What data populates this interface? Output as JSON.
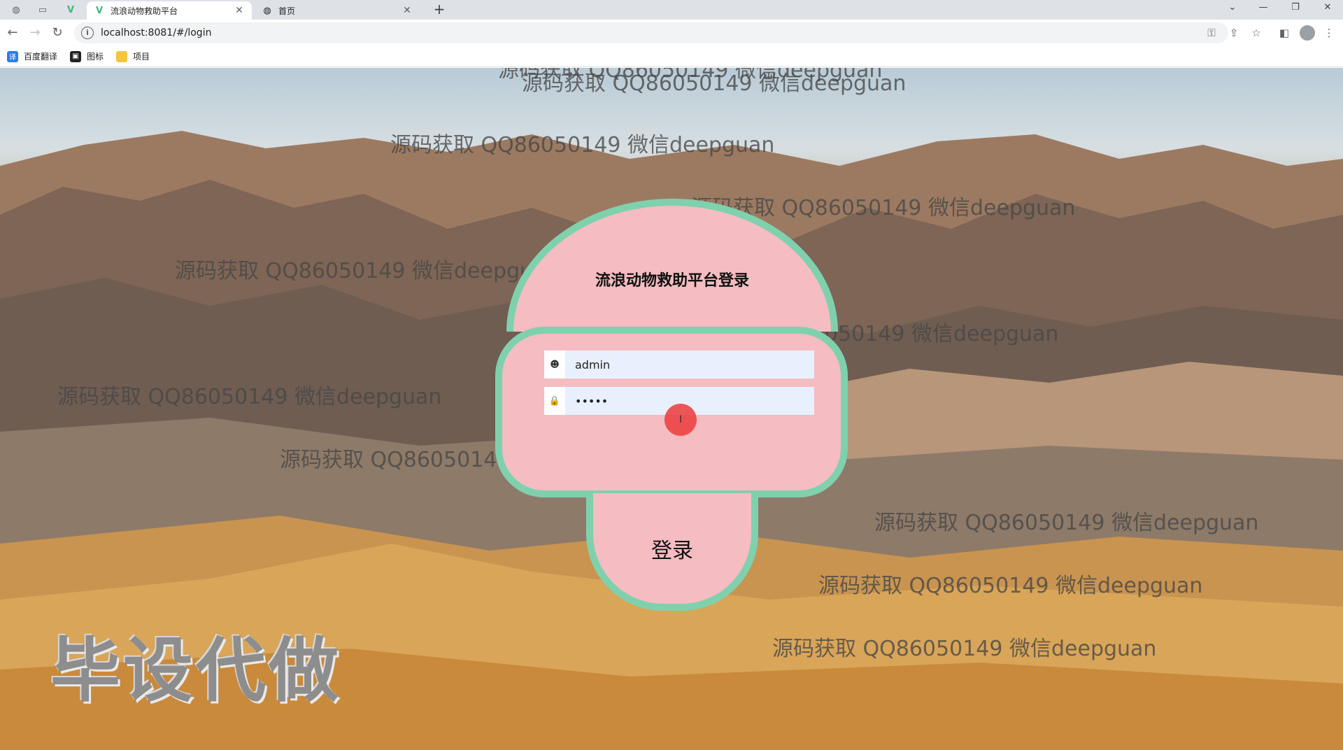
{
  "browser": {
    "tabs": [
      {
        "title": "流浪动物救助平台",
        "active": true
      },
      {
        "title": "首页",
        "active": false
      }
    ],
    "url": "localhost:8081/#/login",
    "bookmarks": [
      {
        "label": "百度翻译",
        "icon": "translate-icon"
      },
      {
        "label": "图标",
        "icon": "image-icon"
      },
      {
        "label": "项目",
        "icon": "folder-icon"
      }
    ]
  },
  "watermarks": [
    "源码获取 QQ86050149 微信deepguan",
    "源码获取 QQ86050149 微信deepguan",
    "源码获取 QQ86050149 微信deepguan",
    "源码获取 QQ86050149 微信deepguan",
    "源码获取 QQ86050149 微信deepguan",
    "源码获取 QQ86050149 微信deepguan",
    "源码获取 QQ86050149 微信deepguan",
    "源码获取 QQ86050149 微信deepguan",
    "源码获取 QQ86050149 微信deepguan",
    "源码获取 QQ86050149 微信deepguan",
    "源码获取 QQ86050149 微信deepguan"
  ],
  "big_watermark": "毕设代做",
  "login": {
    "title": "流浪动物救助平台登录",
    "username": "admin",
    "password": "•••••",
    "submit_label": "登录"
  },
  "colors": {
    "panel": "#f5bcc2",
    "border": "#7fd1ae",
    "input_bg": "#e8f0fe"
  }
}
